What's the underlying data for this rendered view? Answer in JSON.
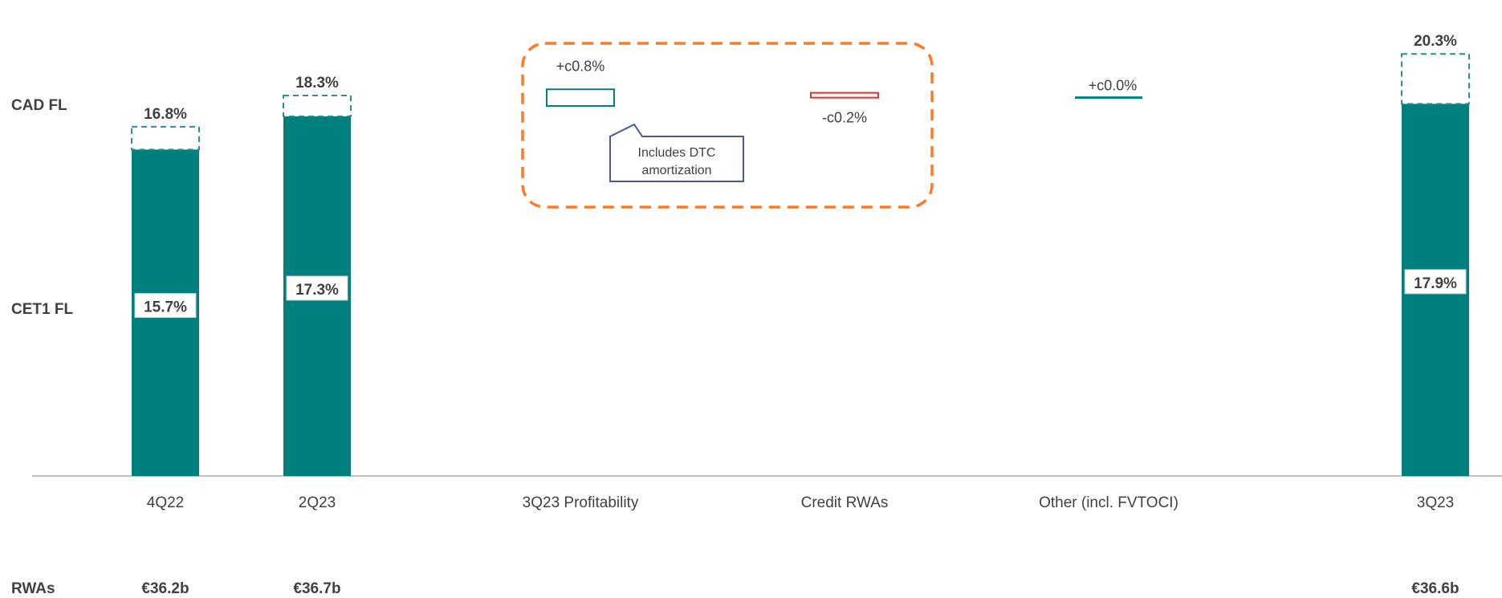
{
  "row_labels": {
    "cad": "CAD FL",
    "cet1": "CET1 FL",
    "rwas": "RWAs"
  },
  "colors": {
    "teal": "#007f7f",
    "teal_dashed": "#2f8f8a",
    "negative": "#e03030",
    "highlight": "#ff7a20",
    "callout_border": "#4a5a8a",
    "axis": "#bfbfbf"
  },
  "annotations": {
    "callout_text": [
      "Includes DTC",
      "amortization"
    ]
  },
  "chart_data": {
    "type": "bar",
    "categories": [
      "4Q22",
      "2Q23",
      "3Q23 Profitability",
      "Credit RWAs",
      "Other (incl. FVTOCI)",
      "3Q23"
    ],
    "series": [
      {
        "name": "CET1 FL",
        "values": [
          15.7,
          17.3,
          null,
          null,
          null,
          17.9
        ],
        "labels": [
          "15.7%",
          "17.3%",
          "",
          "",
          "",
          "17.9%"
        ]
      },
      {
        "name": "CAD FL",
        "values": [
          16.8,
          18.3,
          null,
          null,
          null,
          20.3
        ],
        "labels": [
          "16.8%",
          "18.3%",
          "",
          "",
          "",
          "20.3%"
        ]
      }
    ],
    "deltas": [
      {
        "category": "3Q23 Profitability",
        "value": 0.8,
        "label": "+c0.8%"
      },
      {
        "category": "Credit RWAs",
        "value": -0.2,
        "label": "-c0.2%"
      },
      {
        "category": "Other (incl. FVTOCI)",
        "value": 0.0,
        "label": "+c0.0%"
      }
    ],
    "rwas": [
      "€36.2b",
      "€36.7b",
      "",
      "",
      "",
      "€36.6b"
    ],
    "ylim": [
      0,
      21
    ],
    "grid": false,
    "legend": "none"
  }
}
